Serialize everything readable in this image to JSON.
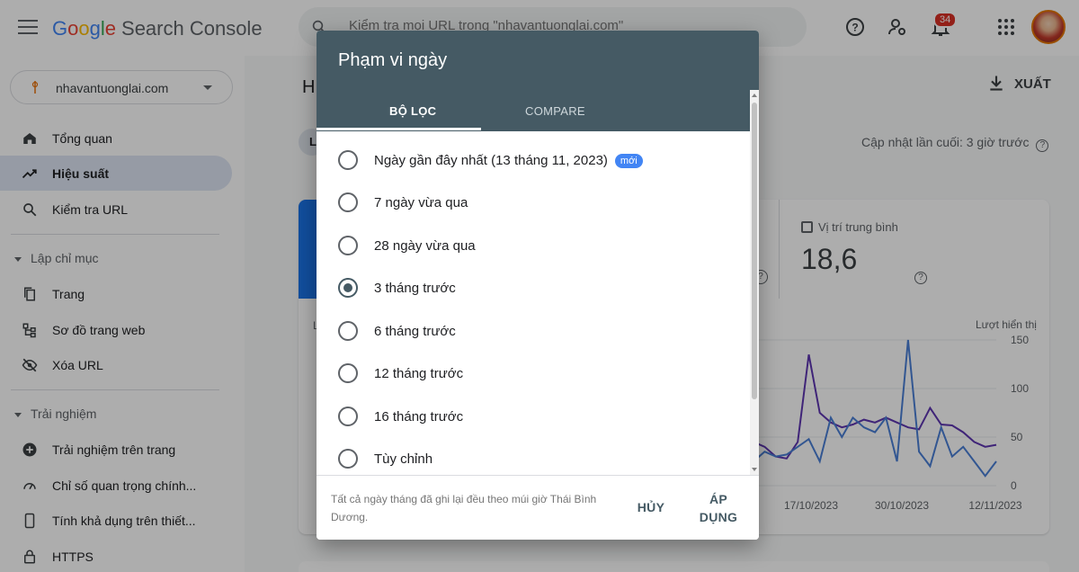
{
  "header": {
    "logo_parts": [
      "G",
      "o",
      "o",
      "g",
      "l",
      "e"
    ],
    "product": "Search Console",
    "search_placeholder": "Kiểm tra mọi URL trong \"nhavantuonglai.com\"",
    "notification_count": "34"
  },
  "sidebar": {
    "property": "nhavantuonglai.com",
    "items": [
      {
        "label": "Tổng quan",
        "icon": "home-icon"
      },
      {
        "label": "Hiệu suất",
        "icon": "trending-up-icon",
        "active": true
      },
      {
        "label": "Kiểm tra URL",
        "icon": "search-icon"
      }
    ],
    "section_index": "Lập chỉ mục",
    "index_items": [
      {
        "label": "Trang",
        "icon": "pages-icon"
      },
      {
        "label": "Sơ đồ trang web",
        "icon": "sitemap-icon"
      },
      {
        "label": "Xóa URL",
        "icon": "visibility-off-icon"
      }
    ],
    "section_experience": "Trải nghiệm",
    "experience_items": [
      {
        "label": "Trải nghiệm trên trang",
        "icon": "add-circle-icon"
      },
      {
        "label": "Chỉ số quan trọng chính...",
        "icon": "speed-icon"
      },
      {
        "label": "Tính khả dụng trên thiết...",
        "icon": "phone-icon"
      },
      {
        "label": "HTTPS",
        "icon": "lock-icon"
      }
    ]
  },
  "main": {
    "title_initial": "H",
    "export_label": "XUẤT",
    "chip_initial": "L",
    "last_updated": "Cập nhật lần cuối: 3 giờ trước",
    "metric_avg_position": {
      "label": "Vị trí trung bình",
      "value": "18,6"
    },
    "chart_side_initial": "L"
  },
  "chart_data": {
    "type": "line",
    "ylabel": "Lượt hiển thị",
    "ylim": [
      0,
      150
    ],
    "yticks": [
      "150",
      "100",
      "50",
      "0"
    ],
    "xticks": [
      "17/10/2023",
      "30/10/2023",
      "12/11/2023"
    ],
    "series": [
      {
        "name": "",
        "color": "#5e35b1",
        "values": [
          null,
          null,
          null,
          null,
          null,
          null,
          null,
          50,
          45,
          40,
          30,
          28,
          45,
          135,
          75,
          65,
          60,
          63,
          68,
          65,
          70,
          65,
          60,
          58,
          80,
          63,
          62,
          55,
          45,
          40,
          42
        ]
      },
      {
        "name": "",
        "color": "#4a7fd6",
        "values": [
          null,
          null,
          null,
          null,
          null,
          null,
          null,
          12,
          25,
          35,
          30,
          32,
          40,
          48,
          25,
          70,
          50,
          70,
          60,
          55,
          70,
          25,
          150,
          35,
          20,
          60,
          30,
          40,
          25,
          10,
          25
        ]
      }
    ]
  },
  "dialog": {
    "title": "Phạm vi ngày",
    "tabs": [
      "BỘ LỌC",
      "COMPARE"
    ],
    "options": [
      {
        "label": "Ngày gần đây nhất (13 tháng 11, 2023)",
        "badge": "mới",
        "selected": false
      },
      {
        "label": "7 ngày vừa qua",
        "selected": false
      },
      {
        "label": "28 ngày vừa qua",
        "selected": false
      },
      {
        "label": "3 tháng trước",
        "selected": true
      },
      {
        "label": "6 tháng trước",
        "selected": false
      },
      {
        "label": "12 tháng trước",
        "selected": false
      },
      {
        "label": "16 tháng trước",
        "selected": false
      },
      {
        "label": "Tùy chỉnh",
        "selected": false
      }
    ],
    "footnote": "Tất cả ngày tháng đã ghi lại đều theo múi giờ Thái Bình Dương.",
    "cancel_label": "HỦY",
    "apply_label": "ÁP DỤNG"
  }
}
